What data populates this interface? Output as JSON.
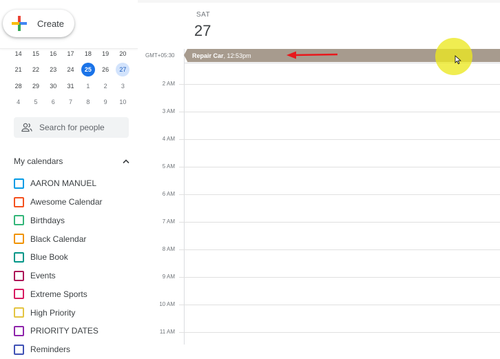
{
  "sidebar": {
    "create_label": "Create",
    "mini_calendar": {
      "rows": [
        [
          {
            "d": "14"
          },
          {
            "d": "15"
          },
          {
            "d": "16"
          },
          {
            "d": "17"
          },
          {
            "d": "18"
          },
          {
            "d": "19"
          },
          {
            "d": "20"
          }
        ],
        [
          {
            "d": "21"
          },
          {
            "d": "22"
          },
          {
            "d": "23"
          },
          {
            "d": "24"
          },
          {
            "d": "25",
            "state": "today"
          },
          {
            "d": "26"
          },
          {
            "d": "27",
            "state": "selected"
          }
        ],
        [
          {
            "d": "28"
          },
          {
            "d": "29"
          },
          {
            "d": "30"
          },
          {
            "d": "31"
          },
          {
            "d": "1",
            "state": "other"
          },
          {
            "d": "2",
            "state": "other"
          },
          {
            "d": "3",
            "state": "other"
          }
        ],
        [
          {
            "d": "4",
            "state": "other"
          },
          {
            "d": "5",
            "state": "other"
          },
          {
            "d": "6",
            "state": "other"
          },
          {
            "d": "7",
            "state": "other"
          },
          {
            "d": "8",
            "state": "other"
          },
          {
            "d": "9",
            "state": "other"
          },
          {
            "d": "10",
            "state": "other"
          }
        ]
      ]
    },
    "search_people_placeholder": "Search for people",
    "my_calendars": {
      "title": "My calendars",
      "items": [
        {
          "label": "AARON MANUEL",
          "color": "#039be5"
        },
        {
          "label": "Awesome Calendar",
          "color": "#f4511e"
        },
        {
          "label": "Birthdays",
          "color": "#33b679"
        },
        {
          "label": "Black Calendar",
          "color": "#f09300"
        },
        {
          "label": "Blue Book",
          "color": "#009688"
        },
        {
          "label": "Events",
          "color": "#ad1457"
        },
        {
          "label": "Extreme Sports",
          "color": "#d81b60"
        },
        {
          "label": "High Priority",
          "color": "#e4c441"
        },
        {
          "label": "PRIORITY DATES",
          "color": "#8e24aa"
        },
        {
          "label": "Reminders",
          "color": "#3f51b5"
        }
      ]
    }
  },
  "main": {
    "day_name": "SAT",
    "day_number": "27",
    "timezone": "GMT+05:30",
    "event": {
      "title": "Repair Car",
      "separator": ", ",
      "time": "12:53pm",
      "color": "#a79b8e"
    },
    "hours": [
      "2 AM",
      "3 AM",
      "4 AM",
      "5 AM",
      "6 AM",
      "7 AM",
      "8 AM",
      "9 AM",
      "10 AM",
      "11 AM"
    ]
  },
  "annotations": {
    "arrow_color": "#e8181c",
    "highlight_color": "#ece820"
  }
}
